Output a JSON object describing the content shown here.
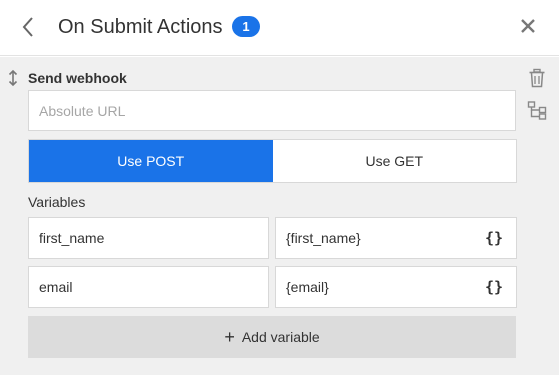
{
  "header": {
    "title": "On Submit Actions",
    "count": "1"
  },
  "action": {
    "title": "Send webhook",
    "url": {
      "value": "",
      "placeholder": "Absolute URL"
    },
    "methods": [
      {
        "label": "Use POST",
        "active": true
      },
      {
        "label": "Use GET",
        "active": false
      }
    ],
    "variables_label": "Variables",
    "variables": [
      {
        "name": "first_name",
        "value": "{first_name}"
      },
      {
        "name": "email",
        "value": "{email}"
      }
    ],
    "add_variable_label": "Add variable",
    "braces_symbol": "{}"
  },
  "icons": {
    "back": "chevron-left-icon",
    "close": "close-icon",
    "drag": "drag-vertical-icon",
    "delete": "trash-icon",
    "flow": "flow-branch-icon",
    "add": "plus-icon"
  },
  "colors": {
    "accent": "#1a73e8",
    "panel_bg": "#f0f0f0",
    "add_button_bg": "#dcdcdc"
  }
}
